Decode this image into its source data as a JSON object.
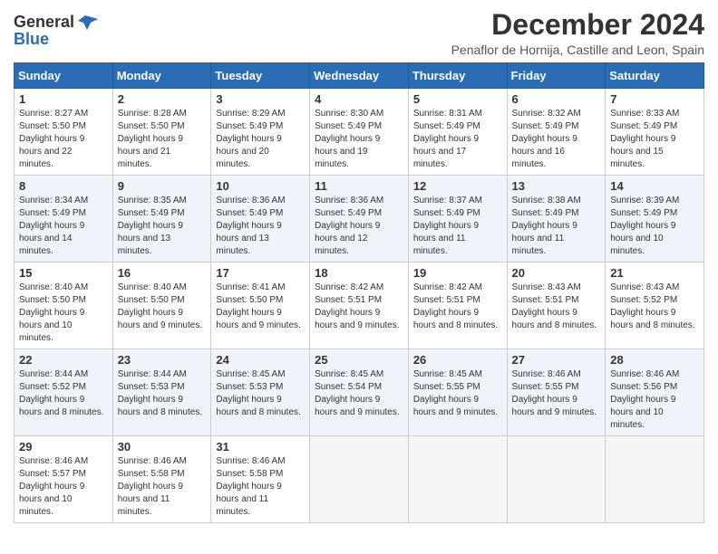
{
  "logo": {
    "general": "General",
    "blue": "Blue"
  },
  "title": "December 2024",
  "location": "Penaflor de Hornija, Castille and Leon, Spain",
  "days_of_week": [
    "Sunday",
    "Monday",
    "Tuesday",
    "Wednesday",
    "Thursday",
    "Friday",
    "Saturday"
  ],
  "weeks": [
    [
      {
        "day": "1",
        "sunrise": "8:27 AM",
        "sunset": "5:50 PM",
        "daylight": "9 hours and 22 minutes."
      },
      {
        "day": "2",
        "sunrise": "8:28 AM",
        "sunset": "5:50 PM",
        "daylight": "9 hours and 21 minutes."
      },
      {
        "day": "3",
        "sunrise": "8:29 AM",
        "sunset": "5:49 PM",
        "daylight": "9 hours and 20 minutes."
      },
      {
        "day": "4",
        "sunrise": "8:30 AM",
        "sunset": "5:49 PM",
        "daylight": "9 hours and 19 minutes."
      },
      {
        "day": "5",
        "sunrise": "8:31 AM",
        "sunset": "5:49 PM",
        "daylight": "9 hours and 17 minutes."
      },
      {
        "day": "6",
        "sunrise": "8:32 AM",
        "sunset": "5:49 PM",
        "daylight": "9 hours and 16 minutes."
      },
      {
        "day": "7",
        "sunrise": "8:33 AM",
        "sunset": "5:49 PM",
        "daylight": "9 hours and 15 minutes."
      }
    ],
    [
      {
        "day": "8",
        "sunrise": "8:34 AM",
        "sunset": "5:49 PM",
        "daylight": "9 hours and 14 minutes."
      },
      {
        "day": "9",
        "sunrise": "8:35 AM",
        "sunset": "5:49 PM",
        "daylight": "9 hours and 13 minutes."
      },
      {
        "day": "10",
        "sunrise": "8:36 AM",
        "sunset": "5:49 PM",
        "daylight": "9 hours and 13 minutes."
      },
      {
        "day": "11",
        "sunrise": "8:36 AM",
        "sunset": "5:49 PM",
        "daylight": "9 hours and 12 minutes."
      },
      {
        "day": "12",
        "sunrise": "8:37 AM",
        "sunset": "5:49 PM",
        "daylight": "9 hours and 11 minutes."
      },
      {
        "day": "13",
        "sunrise": "8:38 AM",
        "sunset": "5:49 PM",
        "daylight": "9 hours and 11 minutes."
      },
      {
        "day": "14",
        "sunrise": "8:39 AM",
        "sunset": "5:49 PM",
        "daylight": "9 hours and 10 minutes."
      }
    ],
    [
      {
        "day": "15",
        "sunrise": "8:40 AM",
        "sunset": "5:50 PM",
        "daylight": "9 hours and 10 minutes."
      },
      {
        "day": "16",
        "sunrise": "8:40 AM",
        "sunset": "5:50 PM",
        "daylight": "9 hours and 9 minutes."
      },
      {
        "day": "17",
        "sunrise": "8:41 AM",
        "sunset": "5:50 PM",
        "daylight": "9 hours and 9 minutes."
      },
      {
        "day": "18",
        "sunrise": "8:42 AM",
        "sunset": "5:51 PM",
        "daylight": "9 hours and 9 minutes."
      },
      {
        "day": "19",
        "sunrise": "8:42 AM",
        "sunset": "5:51 PM",
        "daylight": "9 hours and 8 minutes."
      },
      {
        "day": "20",
        "sunrise": "8:43 AM",
        "sunset": "5:51 PM",
        "daylight": "9 hours and 8 minutes."
      },
      {
        "day": "21",
        "sunrise": "8:43 AM",
        "sunset": "5:52 PM",
        "daylight": "9 hours and 8 minutes."
      }
    ],
    [
      {
        "day": "22",
        "sunrise": "8:44 AM",
        "sunset": "5:52 PM",
        "daylight": "9 hours and 8 minutes."
      },
      {
        "day": "23",
        "sunrise": "8:44 AM",
        "sunset": "5:53 PM",
        "daylight": "9 hours and 8 minutes."
      },
      {
        "day": "24",
        "sunrise": "8:45 AM",
        "sunset": "5:53 PM",
        "daylight": "9 hours and 8 minutes."
      },
      {
        "day": "25",
        "sunrise": "8:45 AM",
        "sunset": "5:54 PM",
        "daylight": "9 hours and 9 minutes."
      },
      {
        "day": "26",
        "sunrise": "8:45 AM",
        "sunset": "5:55 PM",
        "daylight": "9 hours and 9 minutes."
      },
      {
        "day": "27",
        "sunrise": "8:46 AM",
        "sunset": "5:55 PM",
        "daylight": "9 hours and 9 minutes."
      },
      {
        "day": "28",
        "sunrise": "8:46 AM",
        "sunset": "5:56 PM",
        "daylight": "9 hours and 10 minutes."
      }
    ],
    [
      {
        "day": "29",
        "sunrise": "8:46 AM",
        "sunset": "5:57 PM",
        "daylight": "9 hours and 10 minutes."
      },
      {
        "day": "30",
        "sunrise": "8:46 AM",
        "sunset": "5:58 PM",
        "daylight": "9 hours and 11 minutes."
      },
      {
        "day": "31",
        "sunrise": "8:46 AM",
        "sunset": "5:58 PM",
        "daylight": "9 hours and 11 minutes."
      },
      null,
      null,
      null,
      null
    ]
  ]
}
